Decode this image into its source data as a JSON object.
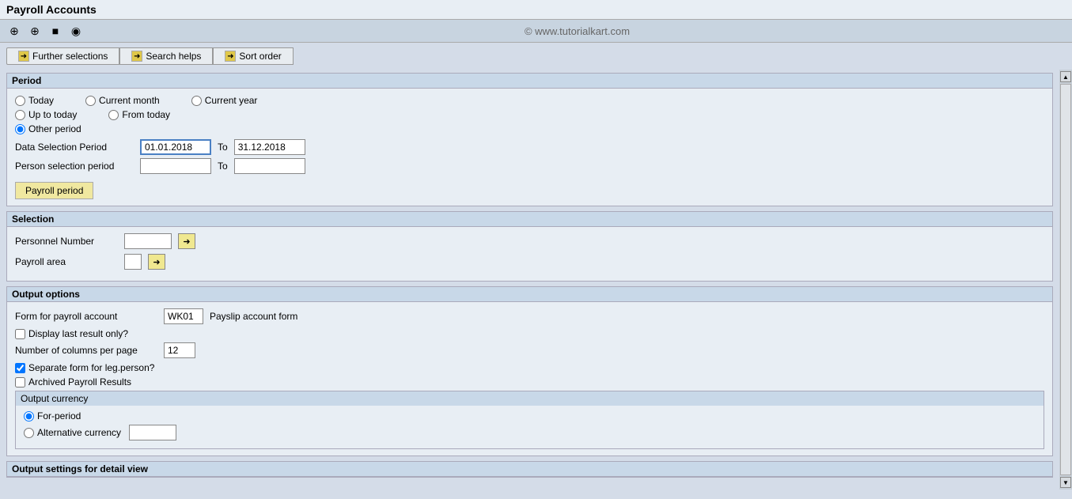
{
  "title": "Payroll Accounts",
  "toolbar": {
    "icons": [
      "⊕",
      "⊕",
      "■",
      "◉"
    ]
  },
  "watermark": "© www.tutorialkart.com",
  "tabs": [
    {
      "label": "Further selections",
      "has_arrow": true
    },
    {
      "label": "Search helps",
      "has_arrow": true
    },
    {
      "label": "Sort order",
      "has_arrow": true
    }
  ],
  "period_section": {
    "title": "Period",
    "radio_options": [
      {
        "label": "Today",
        "name": "period",
        "value": "today"
      },
      {
        "label": "Current month",
        "name": "period",
        "value": "current_month"
      },
      {
        "label": "Current year",
        "name": "period",
        "value": "current_year"
      },
      {
        "label": "Up to today",
        "name": "period",
        "value": "up_to_today"
      },
      {
        "label": "From today",
        "name": "period",
        "value": "from_today"
      },
      {
        "label": "Other period",
        "name": "period",
        "value": "other_period",
        "checked": true
      }
    ],
    "data_selection": {
      "label": "Data Selection Period",
      "from_value": "01.01.2018",
      "to_label": "To",
      "to_value": "31.12.2018"
    },
    "person_selection": {
      "label": "Person selection period",
      "from_value": "",
      "to_label": "To",
      "to_value": ""
    },
    "payroll_period_btn": "Payroll period"
  },
  "selection_section": {
    "title": "Selection",
    "fields": [
      {
        "label": "Personnel Number",
        "value": "",
        "width": 60
      },
      {
        "label": "Payroll area",
        "value": "",
        "width": 22
      }
    ]
  },
  "output_options": {
    "title": "Output options",
    "form_label": "Form for payroll account",
    "form_value": "WK01",
    "form_desc": "Payslip account form",
    "display_last_label": "Display last result only?",
    "display_last_checked": false,
    "columns_label": "Number of columns per page",
    "columns_value": "12",
    "separate_form_label": "Separate form for leg.person?",
    "separate_form_checked": true,
    "archived_label": "Archived Payroll Results",
    "archived_checked": false,
    "currency": {
      "title": "Output currency",
      "options": [
        {
          "label": "For-period",
          "checked": true
        },
        {
          "label": "Alternative currency",
          "checked": false
        }
      ],
      "alt_currency_value": ""
    }
  },
  "output_detail": {
    "title": "Output settings for detail view"
  }
}
